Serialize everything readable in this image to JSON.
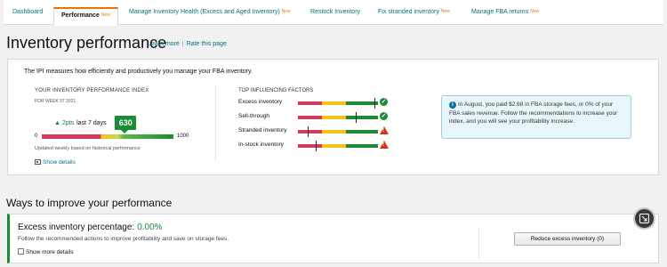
{
  "tabs": [
    {
      "label": "Dashboard",
      "badge": ""
    },
    {
      "label": "Performance",
      "badge": "New"
    },
    {
      "label": "Manage Inventory Health (Excess and Aged Inventory)",
      "badge": "New"
    },
    {
      "label": "Restock Inventory",
      "badge": ""
    },
    {
      "label": "Fix stranded inventory",
      "badge": "New"
    },
    {
      "label": "Manage FBA returns",
      "badge": "New"
    }
  ],
  "header": {
    "title": "Inventory performance",
    "learn_more": "Learn more",
    "separator": "|",
    "rate_page": "Rate this page"
  },
  "ipi": {
    "description": "The IPI measures how efficiently and productively you manage your FBA inventory.",
    "heading": "YOUR INVENTORY PERFORMANCE INDEX",
    "week": "FOR WEEK 37 2021",
    "trend_value": "▲ 2pts",
    "trend_label": "last 7 days",
    "score": "630",
    "score_fraction": 0.63,
    "min": "0",
    "max": "1000",
    "caption": "Updated weekly based on historical performance",
    "show_details": "Show details"
  },
  "factors": {
    "heading": "TOP INFLUENCING FACTORS",
    "items": [
      {
        "label": "Excess inventory",
        "status": "ok",
        "level": 0.95
      },
      {
        "label": "Sell-through",
        "status": "ok",
        "level": 0.72
      },
      {
        "label": "Stranded inventory",
        "status": "warning",
        "level": 0.12
      },
      {
        "label": "In-stock inventory",
        "status": "warning",
        "level": 0.22
      }
    ]
  },
  "info": {
    "text": "In August, you paid $2.68 in FBA storage fees, or 0% of your FBA sales revenue. Follow the recommendations to increase your index, and you will see your profitability increase."
  },
  "improve": {
    "title": "Ways to improve your performance",
    "excess_label": "Excess inventory percentage:",
    "excess_value": "0.00%",
    "excess_desc": "Follow the recommended actions to improve profitability and save on storage fees.",
    "show_more": "Show more details",
    "reduce_button": "Reduce excess inventory (0)"
  },
  "colors": {
    "link": "#007185",
    "accent": "#e77600",
    "good": "#1a8c34",
    "warning": "#d13212"
  }
}
